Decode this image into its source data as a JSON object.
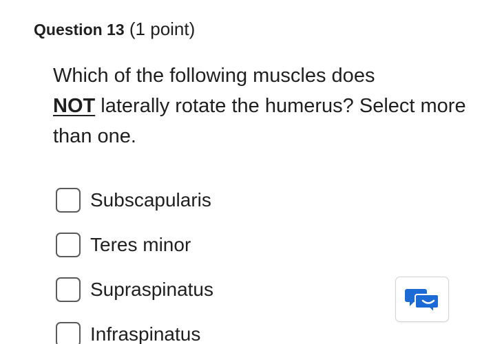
{
  "question": {
    "number_label": "Question 13",
    "points_label": "(1 point)",
    "emphasis": "NOT",
    "text_before": "Which of the following muscles does",
    "text_after": "laterally rotate the humerus? Select more than one."
  },
  "options": [
    {
      "label": "Subscapularis",
      "checked": false
    },
    {
      "label": "Teres minor",
      "checked": false
    },
    {
      "label": "Supraspinatus",
      "checked": false
    },
    {
      "label": "Infraspinatus",
      "checked": false
    }
  ],
  "chat_widget": {
    "icon": "chat-bubbles-icon",
    "accent": "#1b6ad6"
  }
}
